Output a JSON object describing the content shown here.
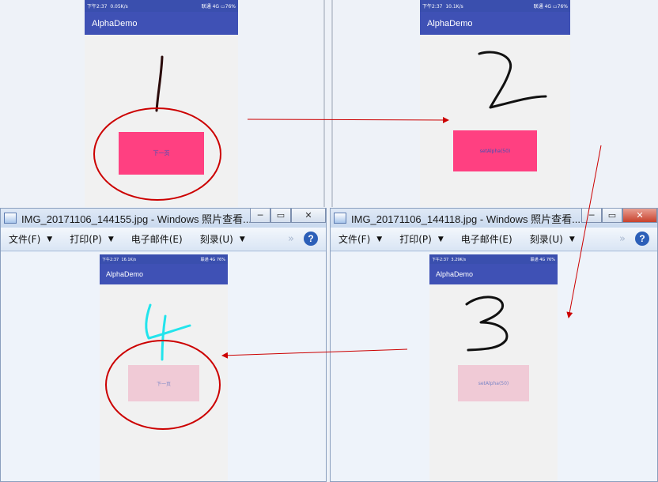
{
  "android": {
    "time": "下午2:37",
    "signal": "联通 4G",
    "battery": "76%",
    "app_title": "AlphaDemo",
    "next_button": "下一页",
    "alpha_button": "setAlpha(50)",
    "net_speeds": [
      "0.05K/s",
      "10.1K/s",
      "16.1K/s",
      "3.29K/s"
    ]
  },
  "windows": [
    {
      "title": "IMG_20171106_144155.jpg - Windows 照片查看..."
    },
    {
      "title": "IMG_20171106_144118.jpg - Windows 照片查看..."
    }
  ],
  "viewer_menu": {
    "file": "文件(F)",
    "print": "打印(P)",
    "email": "电子邮件(E)",
    "burn": "刻录(U)"
  },
  "controls": {
    "minimize": "─",
    "maximize": "▭",
    "close": "✕",
    "more": "»",
    "help": "?"
  },
  "colors": {
    "primary": "#3f51b5",
    "accent_button": "#ff4081",
    "faded_button": "#f0cad6",
    "annotation_red": "#cc0000",
    "digit_cyan": "#22e4ec"
  }
}
